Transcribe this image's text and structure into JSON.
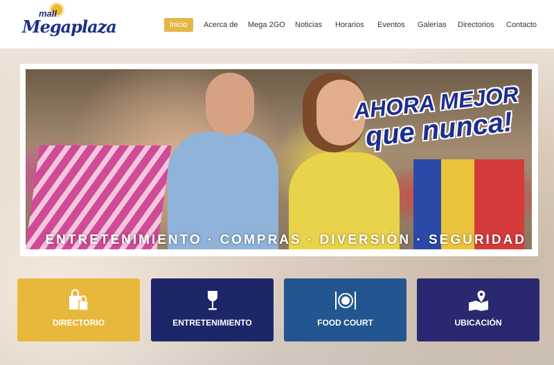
{
  "logo": {
    "text_small": "mall",
    "text_main": "Megaplaza"
  },
  "nav": [
    "Inicio",
    "Acerca de",
    "Mega 2GO",
    "Noticias",
    "Horarios",
    "Eventos",
    "Galerías",
    "Directorios",
    "Contacto"
  ],
  "banner": {
    "headline_1": "AHORA MEJOR",
    "headline_2": "que nunca!",
    "tagline": "ENTRETENIMIENTO · COMPRAS · DIVERSIÓN · SEGURIDAD"
  },
  "cards": [
    {
      "label": "DIRECTORIO",
      "icon": "shopping-bags-icon",
      "color": "#E8B83C"
    },
    {
      "label": "ENTRETENIMIENTO",
      "icon": "wine-glass-icon",
      "color": "#1E266A"
    },
    {
      "label": "FOOD COURT",
      "icon": "plate-cutlery-icon",
      "color": "#235690"
    },
    {
      "label": "UBICACIÓN",
      "icon": "map-pin-icon",
      "color": "#2A2870"
    }
  ]
}
